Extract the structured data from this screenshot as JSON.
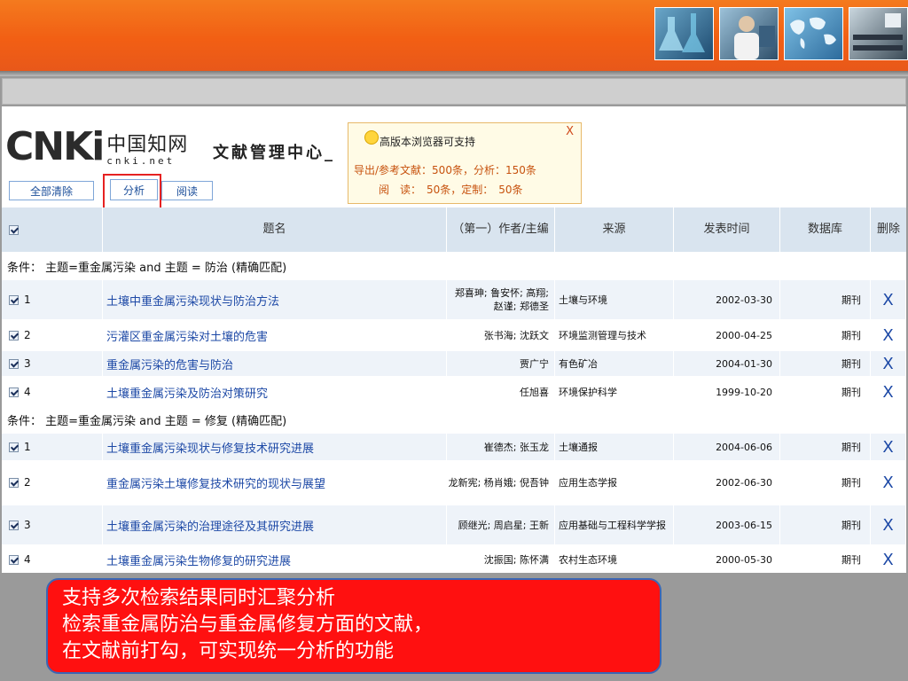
{
  "header": {
    "photos": [
      "lab-flask-photo",
      "scientist-photo",
      "world-map-photo",
      "classroom-photo"
    ]
  },
  "logo": {
    "brand": "CNKi",
    "chinese": "中国知网",
    "domain": "cnki.net"
  },
  "app_title": "文献管理中心_",
  "popup": {
    "title": "高版本浏览器可支持",
    "close": "X",
    "line1": "导出/参考文献：500条，分析：150条",
    "line2": "阅　读：　50条，定制：　50条"
  },
  "toolbar": {
    "clear_label": "全部清除",
    "analyze_label": "分析",
    "read_label": "阅读"
  },
  "table": {
    "headers": {
      "title": "题名",
      "author": "（第一）作者/主编",
      "source": "来源",
      "date": "发表时间",
      "db": "数据库",
      "del": "删除"
    },
    "groups": [
      {
        "condition": "条件：  主题=重金属污染  and 主题  = 防治  (精确匹配)",
        "rows": [
          {
            "num": "1",
            "title": "土壤中重金属污染现状与防治方法",
            "author": "郑喜珅; 鲁安怀; 高翔; 赵谨; 郑德圣",
            "source": "土壤与环境",
            "date": "2002-03-30",
            "db": "期刊",
            "del": "X"
          },
          {
            "num": "2",
            "title": "污灌区重金属污染对土壤的危害",
            "author": "张书海; 沈跃文",
            "source": "环境监测管理与技术",
            "date": "2000-04-25",
            "db": "期刊",
            "del": "X"
          },
          {
            "num": "3",
            "title": "重金属污染的危害与防治",
            "author": "贾广宁",
            "source": "有色矿冶",
            "date": "2004-01-30",
            "db": "期刊",
            "del": "X"
          },
          {
            "num": "4",
            "title": "土壤重金属污染及防治对策研究",
            "author": "任旭喜",
            "source": "环境保护科学",
            "date": "1999-10-20",
            "db": "期刊",
            "del": "X"
          }
        ]
      },
      {
        "condition": "条件：  主题=重金属污染  and 主题  = 修复  (精确匹配)",
        "rows": [
          {
            "num": "1",
            "title": "土壤重金属污染现状与修复技术研究进展",
            "author": "崔德杰; 张玉龙",
            "source": "土壤通报",
            "date": "2004-06-06",
            "db": "期刊",
            "del": "X"
          },
          {
            "num": "2",
            "title": "重金属污染土壤修复技术研究的现状与展望",
            "author": "龙新宪; 杨肖娥; 倪吾钟",
            "source": "应用生态学报",
            "date": "2002-06-30",
            "db": "期刊",
            "del": "X"
          },
          {
            "num": "3",
            "title": "土壤重金属污染的治理途径及其研究进展",
            "author": "顾继光; 周启星; 王新",
            "source": "应用基础与工程科学学报",
            "date": "2003-06-15",
            "db": "期刊",
            "del": "X"
          },
          {
            "num": "4",
            "title": "土壤重金属污染生物修复的研究进展",
            "author": "沈振国; 陈怀满",
            "source": "农村生态环境",
            "date": "2000-05-30",
            "db": "期刊",
            "del": "X"
          }
        ]
      }
    ]
  },
  "callout": {
    "line1": "支持多次检索结果同时汇聚分析",
    "line2": "检索重金属防治与重金属修复方面的文献，",
    "line3": "在文献前打勾，可实现统一分析的功能"
  },
  "colors": {
    "banner_orange": "#f25f14",
    "link_blue": "#1d49a6",
    "highlight_red": "#e62121",
    "callout_red": "#ff1010",
    "header_bg": "#d9e4ef"
  }
}
